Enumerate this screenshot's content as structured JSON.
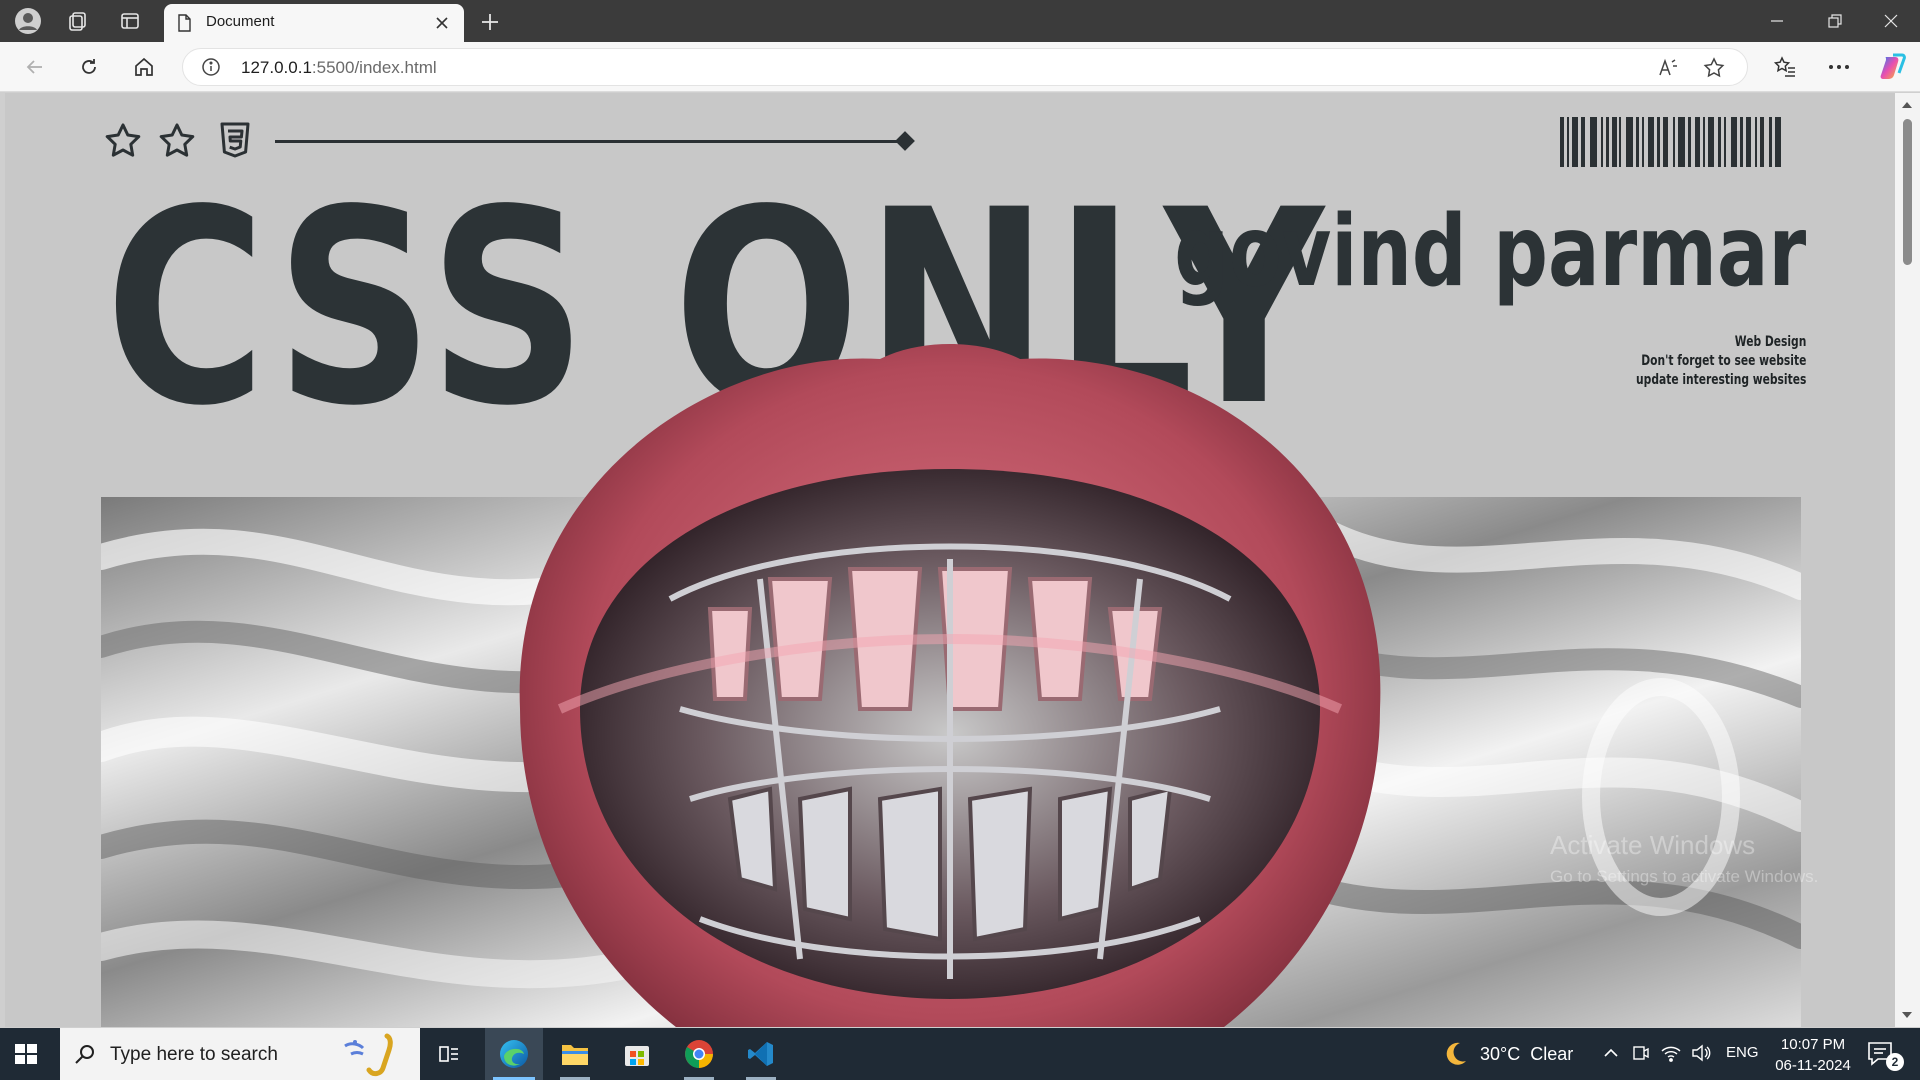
{
  "browser": {
    "tab": {
      "title": "Document",
      "icon": "page-icon"
    },
    "address": {
      "url_host": "127.0.0.1",
      "url_rest": ":5500/index.html"
    }
  },
  "page": {
    "title_text": "CSS ONLY",
    "author": "govind parmar",
    "tagline": [
      "Web Design",
      "Don't forget to see website",
      "update interesting websites"
    ],
    "header_icons": [
      "star-outline-icon",
      "star-outline-icon",
      "css3-icon"
    ],
    "watermark": {
      "title": "Activate Windows",
      "subtitle": "Go to Settings to activate Windows."
    },
    "colors": {
      "background": "#c8c8c8",
      "ink": "#2c3336",
      "lips": "#b24a5a"
    }
  },
  "taskbar": {
    "search_placeholder": "Type here to search",
    "apps": [
      "task-view-icon",
      "edge-icon",
      "file-explorer-icon",
      "microsoft-store-icon",
      "chrome-icon",
      "vscode-icon"
    ],
    "weather": {
      "temp": "30°C",
      "condition": "Clear"
    },
    "language": "ENG",
    "time": "10:07 PM",
    "date": "06-11-2024",
    "notification_count": "2"
  }
}
